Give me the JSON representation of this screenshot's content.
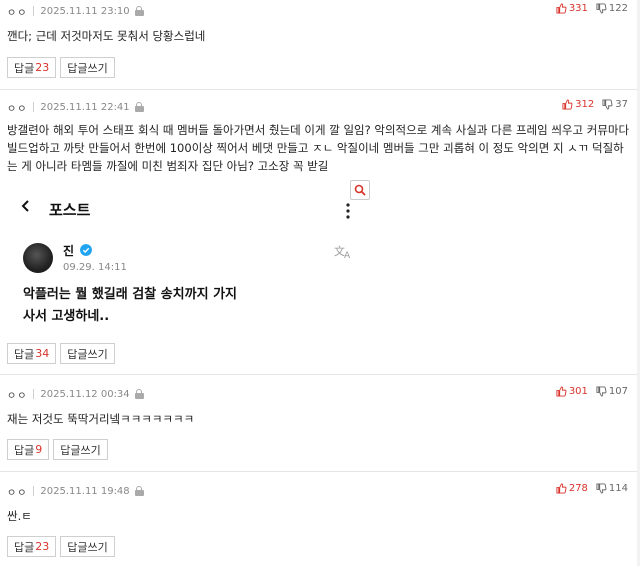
{
  "reply_label": "답글",
  "write_reply_label": "답글쓰기",
  "comments": [
    {
      "nick": "ㅇㅇ",
      "date": "2025.11.11 23:10",
      "up": "331",
      "down": "122",
      "text": "깬다; 근데 저것마저도 못춰서 당황스럽네",
      "reply_count": "23"
    },
    {
      "nick": "ㅇㅇ",
      "date": "2025.11.11 22:41",
      "up": "312",
      "down": "37",
      "text": "방갤련아 해외 투어 스태프 회식 때 멤버들 돌아가면서 췄는데 이게 깔 일임? 악의적으로 계속 사실과 다른 프레임 씌우고 커뮤마다 빌드업하고 까탓 만들어서 한번에 100이상 찍어서 베댓 만들고 ㅈㄴ 악질이네 멤버들 그만 괴롭혀 이 정도 악의면 지 ㅅㄲ 덕질하는 게 아니라 타멤들 까질에 미친 범죄자 집단 아님? 고소장 꼭 받길",
      "reply_count": "34",
      "embed": {
        "header_title": "포스트",
        "user_name": "진",
        "post_time": "09.29. 14:11",
        "post_text_line1": "악플러는 뭘 했길래 검찰 송치까지 가지",
        "post_text_line2": "사서 고생하네.."
      }
    },
    {
      "nick": "ㅇㅇ",
      "date": "2025.11.12 00:34",
      "up": "301",
      "down": "107",
      "text": "재는 저것도 뚝딱거리넼ㅋㅋㅋㅋㅋㅋㅋ",
      "reply_count": "9"
    },
    {
      "nick": "ㅇㅇ",
      "date": "2025.11.11 19:48",
      "up": "278",
      "down": "114",
      "text": "싼.ㅌ",
      "reply_count": "23"
    }
  ],
  "colors": {
    "upvote": "#d8342c",
    "downvote": "#666666",
    "border": "#e6e6e6",
    "verified": "#21a4f0"
  },
  "icons": [
    "lock-icon",
    "thumbs-up-icon",
    "thumbs-down-icon",
    "back-arrow-icon",
    "more-vertical-icon",
    "verified-badge-icon",
    "translate-icon",
    "zoom-search-icon"
  ]
}
